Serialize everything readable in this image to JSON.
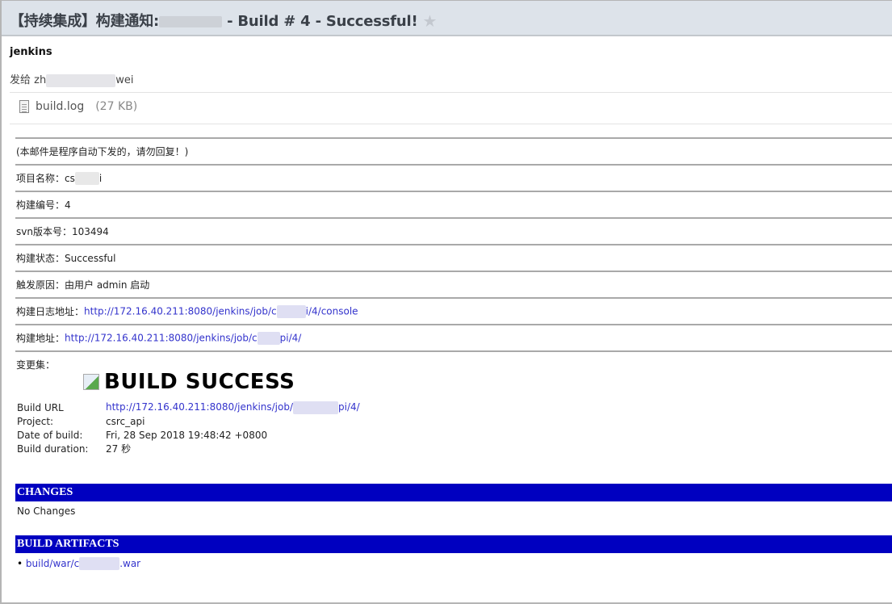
{
  "email": {
    "subject_prefix": "【持续集成】构建通知:",
    "subject_suffix": " - Build # 4 - Successful!",
    "star_icon": "star-icon",
    "sender": "jenkins",
    "recipient_prefix": "发给 zh",
    "recipient_suffix": "wei",
    "attachment": {
      "name": "build.log",
      "size": "(27 KB)",
      "icon": "file-text-icon"
    }
  },
  "notice": {
    "rows": [
      {
        "label": "(本邮件是程序自动下发的，请勿回复！)",
        "value": ""
      },
      {
        "label": "项目名称：",
        "value_prefix": "cs",
        "value_suffix": "i"
      },
      {
        "label": "构建编号：",
        "value": "4"
      },
      {
        "label": "svn版本号：",
        "value": "103494"
      },
      {
        "label": "构建状态：",
        "value": "Successful"
      },
      {
        "label": "触发原因：",
        "value": "由用户 admin 启动"
      },
      {
        "label": "构建日志地址：",
        "link_prefix": "http://172.16.40.211:8080/jenkins/job/c",
        "link_suffix": "i/4/console"
      },
      {
        "label": "构建地址：",
        "link_prefix": "http://172.16.40.211:8080/jenkins/job/c",
        "link_suffix": "pi/4/"
      },
      {
        "label": "变更集：",
        "value": ""
      }
    ]
  },
  "report": {
    "title": "BUILD SUCCESS",
    "details": [
      {
        "key": "Build URL",
        "link_prefix": "http://172.16.40.211:8080/jenkins/job/",
        "link_suffix": "pi/4/"
      },
      {
        "key": "Project:",
        "value": "csrc_api"
      },
      {
        "key": "Date of build:",
        "value": "Fri, 28 Sep 2018 19:48:42 +0800"
      },
      {
        "key": "Build duration:",
        "value": "27 秒"
      }
    ],
    "changes_header": "CHANGES",
    "changes_text": "No Changes",
    "artifacts_header": "BUILD ARTIFACTS",
    "artifacts": [
      {
        "prefix": "build/war/c",
        "suffix": ".war"
      }
    ],
    "colors": {
      "section_bar": "#0000c0",
      "link": "#3333cc"
    }
  }
}
